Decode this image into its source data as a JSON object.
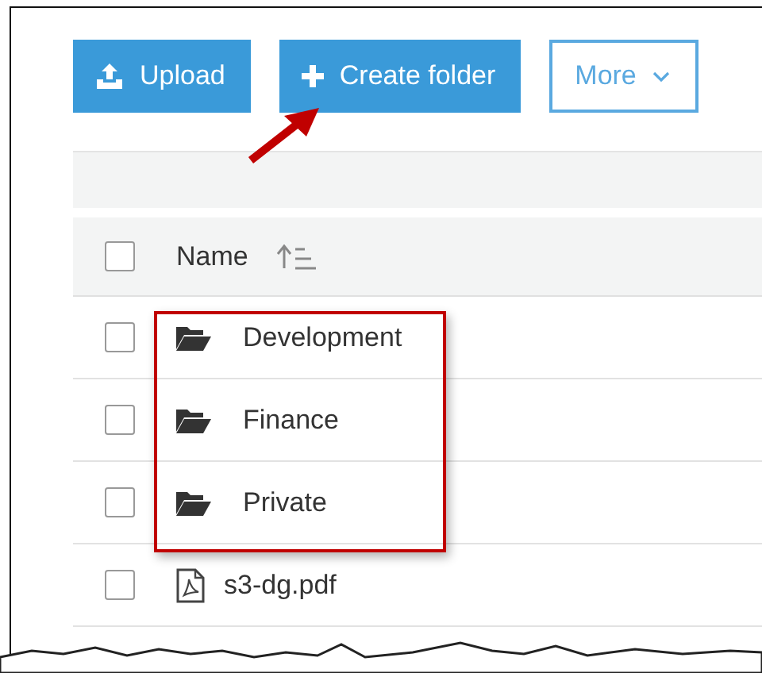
{
  "toolbar": {
    "buttons": [
      {
        "label": "Upload",
        "kind": "upload"
      },
      {
        "label": "Create folder",
        "kind": "create"
      },
      {
        "label": "More",
        "kind": "menu"
      }
    ]
  },
  "table": {
    "header": {
      "checked": false,
      "column": "Name"
    },
    "rows": [
      {
        "name": "Development",
        "kind": "folder",
        "checked": false
      },
      {
        "name": "Finance",
        "kind": "folder",
        "checked": false
      },
      {
        "name": "Private",
        "kind": "folder",
        "checked": false
      },
      {
        "name": "s3-dg.pdf",
        "kind": "pdf",
        "checked": false
      }
    ]
  }
}
